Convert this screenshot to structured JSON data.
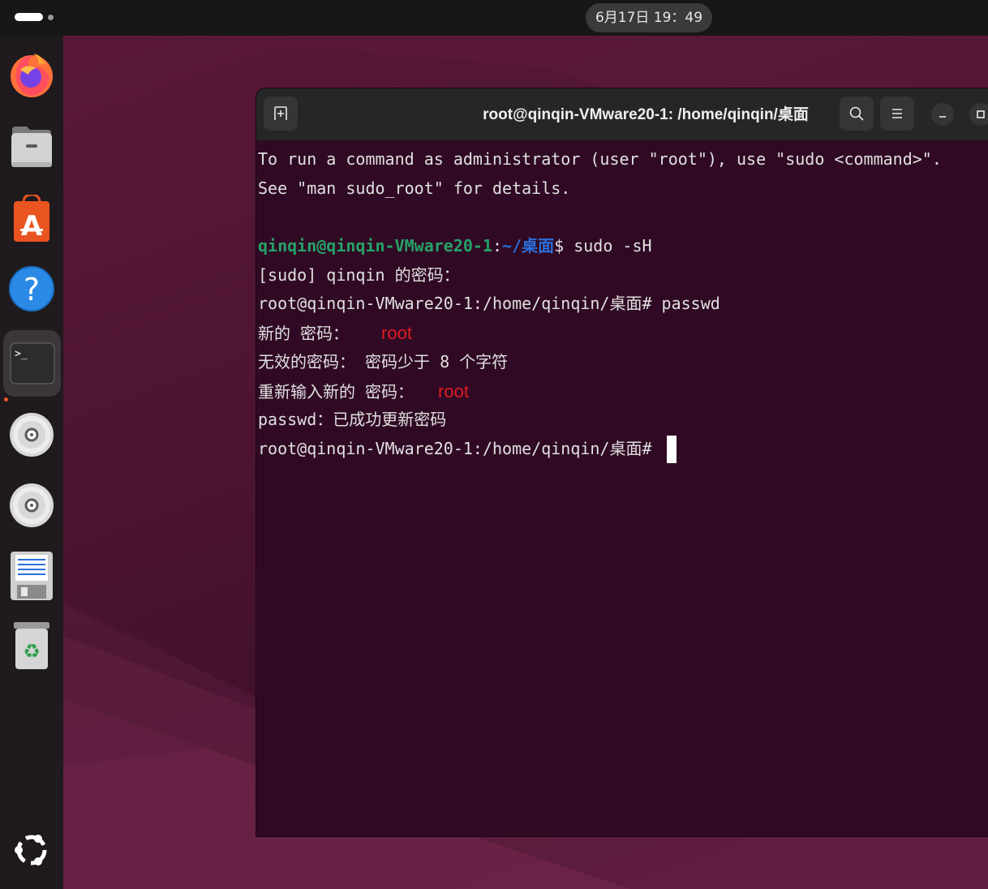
{
  "topbar": {
    "clock": "6月17日  19：49"
  },
  "dock": {
    "items": [
      {
        "name": "firefox",
        "icon": "firefox-icon"
      },
      {
        "name": "files",
        "icon": "files-icon"
      },
      {
        "name": "app-center",
        "icon": "app-center-icon"
      },
      {
        "name": "help",
        "icon": "help-icon",
        "glyph": "?"
      },
      {
        "name": "terminal",
        "icon": "terminal-icon",
        "glyph": ">_",
        "active": true
      },
      {
        "name": "disc-1",
        "icon": "disc-icon"
      },
      {
        "name": "disc-2",
        "icon": "disc-icon"
      },
      {
        "name": "save",
        "icon": "floppy-icon"
      },
      {
        "name": "trash",
        "icon": "trash-icon",
        "glyph": "♻"
      },
      {
        "name": "show-apps",
        "icon": "ubuntu-logo-icon"
      }
    ]
  },
  "terminal": {
    "title": "root@qinqin-VMware20-1: /home/qinqin/桌面",
    "lines": {
      "l1": "To run a command as administrator (user \"root\"), use \"sudo <command>\".",
      "l2": "See \"man sudo_root\" for details.",
      "l4_user": "qinqin@qinqin-VMware20-1",
      "l4_sep": ":",
      "l4_path": "~/桌面",
      "l4_cmd": "$ sudo -sH",
      "l5": "[sudo] qinqin 的密码：",
      "l6": "root@qinqin-VMware20-1:/home/qinqin/桌面# passwd",
      "l7": "新的 密码：",
      "l7_note": "root",
      "l8": "无效的密码： 密码少于 8 个字符",
      "l9": "重新输入新的 密码：",
      "l9_note": "root",
      "l10": "passwd：已成功更新密码",
      "l11": "root@qinqin-VMware20-1:/home/qinqin/桌面# "
    }
  },
  "colors": {
    "terminal_bg": "#300a24",
    "prompt_user": "#26a269",
    "prompt_path": "#2a6fdb",
    "annotation": "#e01b24",
    "accent": "#e95420"
  }
}
